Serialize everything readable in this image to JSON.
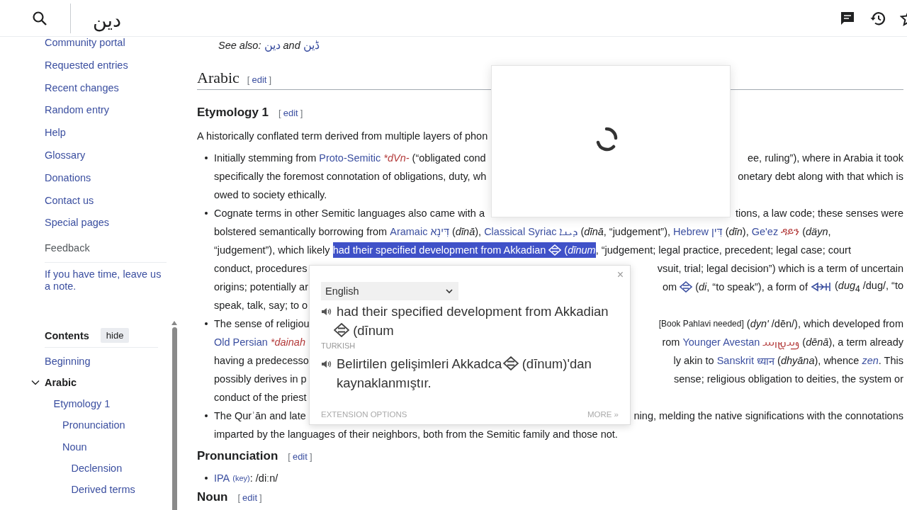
{
  "header": {
    "title": "دين"
  },
  "sidebar": {
    "nav_links": [
      "Community portal",
      "Requested entries",
      "Recent changes",
      "Random entry",
      "Help",
      "Glossary",
      "Donations",
      "Contact us",
      "Special pages"
    ],
    "feedback": {
      "title": "Feedback",
      "note": "If you have time, leave us a note."
    },
    "contents": {
      "title": "Contents",
      "hide_button": "hide",
      "items": [
        {
          "label": "Beginning",
          "selected": false
        },
        {
          "label": "Arabic",
          "selected": true,
          "expanded": true,
          "children": [
            {
              "label": "Etymology 1",
              "selected": false,
              "children": [
                {
                  "label": "Pronunciation",
                  "selected": false
                },
                {
                  "label": "Noun",
                  "selected": false,
                  "children": [
                    {
                      "label": "Declension",
                      "selected": false
                    },
                    {
                      "label": "Derived terms",
                      "selected": false
                    }
                  ]
                }
              ]
            }
          ]
        }
      ]
    }
  },
  "article": [
    {
      "kind": "see_also",
      "segs": [
        {
          "kind": "text",
          "text": "*See also:* "
        },
        {
          "kind": "link",
          "text": "دين"
        },
        {
          "kind": "text",
          "text": " *and* "
        },
        {
          "kind": "link",
          "text": "ڈین"
        }
      ]
    },
    {
      "kind": "h2",
      "text": "Arabic",
      "edit": {
        "open": "[",
        "label": "edit",
        "close": "]"
      }
    },
    {
      "kind": "h3",
      "text": "Etymology 1",
      "edit": {
        "open": "[",
        "label": "edit",
        "close": "]"
      }
    },
    {
      "kind": "para",
      "lines": [
        {
          "left": [
            {
              "kind": "text",
              "text": "A historically conflated term derived from multiple layers of phon"
            }
          ]
        }
      ]
    },
    {
      "kind": "bullet",
      "lines": [
        {
          "left": [
            {
              "kind": "text",
              "text": "Initially stemming from "
            },
            {
              "kind": "link",
              "text": "Proto-Semitic"
            },
            {
              "kind": "red_term",
              "text": "*dVn-"
            },
            {
              "kind": "text",
              "text": " (“obligated cond"
            }
          ],
          "right": [
            {
              "kind": "text",
              "text": "ee, ruling”), where in Arabia it took"
            }
          ]
        },
        {
          "left": [
            {
              "kind": "text",
              "text": "specifically the foremost connotation of obligations, duty, wh"
            }
          ],
          "right": [
            {
              "kind": "text",
              "text": "onetary debt along with that which is"
            }
          ]
        },
        {
          "left": [
            {
              "kind": "text",
              "text": "owed to society ethically."
            }
          ]
        }
      ]
    },
    {
      "kind": "bullet",
      "lines": [
        {
          "left": [
            {
              "kind": "text",
              "text": "Cognate terms in other Semitic languages also came with a"
            }
          ],
          "right": [
            {
              "kind": "text",
              "text": "tions, a law code; these senses were"
            }
          ]
        },
        {
          "left": [
            {
              "kind": "text",
              "text": "bolstered semantically borrowing from "
            },
            {
              "kind": "link",
              "text": "Aramaic"
            },
            {
              "kind": "link",
              "text": "דִּינָא"
            },
            {
              "kind": "text",
              "text": " (*dīnā*), "
            },
            {
              "kind": "link",
              "text": "Classical Syriac"
            },
            {
              "kind": "link",
              "text": "ܕܝܢܐ"
            },
            {
              "kind": "text",
              "text": " (*dīnā*, “judgement”), "
            },
            {
              "kind": "link",
              "text": "Hebrew"
            },
            {
              "kind": "link",
              "text": "דִּין"
            },
            {
              "kind": "text",
              "text": " (*dīn*), "
            },
            {
              "kind": "link",
              "text": "Ge'ez"
            },
            {
              "kind": "red_word",
              "text": "ዳይን"
            },
            {
              "kind": "text",
              "text": " (*däyn*,"
            }
          ]
        },
        {
          "left": [
            {
              "kind": "text",
              "text": "“judgement”), which likely "
            },
            {
              "kind": "text",
              "text": "had their specified development from Akkadian ",
              "highlighted": true
            },
            {
              "kind": "cuneiform",
              "highlighted": true
            },
            {
              "kind": "text",
              "text": " (*dīnum*",
              "highlighted": true
            },
            {
              "kind": "text",
              "text": ", “judgement; legal practice, precedent; legal case; court"
            }
          ]
        },
        {
          "left": [
            {
              "kind": "text",
              "text": "conduct, procedures"
            }
          ],
          "right": [
            {
              "kind": "text",
              "text": "vsuit, trial; legal decision”) which is a term of uncertain"
            }
          ]
        },
        {
          "left": [
            {
              "kind": "text",
              "text": "origins; potentially ar"
            }
          ],
          "right": [
            {
              "kind": "text",
              "text": "om "
            },
            {
              "kind": "cuneiform"
            },
            {
              "kind": "text",
              "text": " (*di*, “to speak”), a form of "
            },
            {
              "kind": "cuneiform_wide"
            },
            {
              "kind": "text",
              "text": " (*dug*$_{4}$ /dug/, “to"
            }
          ]
        },
        {
          "left": [
            {
              "kind": "text",
              "text": "speak, talk, say; to o"
            }
          ]
        }
      ]
    },
    {
      "kind": "bullet",
      "lines": [
        {
          "left": [
            {
              "kind": "text",
              "text": "The sense of religiou"
            }
          ],
          "right": [
            {
              "kind": "note",
              "text": "[Book Pahlavi needed]"
            },
            {
              "kind": "text",
              "text": " (*dyn'* /dēn/), which developed from"
            }
          ]
        },
        {
          "left": [
            {
              "kind": "link",
              "text": "Old Persian"
            },
            {
              "kind": "red_term",
              "text": "*dainah"
            }
          ],
          "right": [
            {
              "kind": "text",
              "text": "rom "
            },
            {
              "kind": "link",
              "text": "Younger Avestan"
            },
            {
              "kind": "red_word",
              "text": "𐬛𐬀𐬉𐬥𐬁"
            },
            {
              "kind": "text",
              "text": " (*dēnā*), a term already"
            }
          ]
        },
        {
          "left": [
            {
              "kind": "text",
              "text": "having a predecesso"
            }
          ],
          "right": [
            {
              "kind": "text",
              "text": "ly akin to "
            },
            {
              "kind": "link",
              "text": "Sanskrit"
            },
            {
              "kind": "link",
              "text": "ध्यान"
            },
            {
              "kind": "text",
              "text": " (*dhyāna*), whence "
            },
            {
              "kind": "link",
              "text": "*zen*"
            },
            {
              "kind": "text",
              "text": ". This"
            }
          ]
        },
        {
          "left": [
            {
              "kind": "text",
              "text": "possibly derives in p"
            }
          ],
          "right": [
            {
              "kind": "text",
              "text": "sense; religious obligation to deities, the system or"
            }
          ]
        },
        {
          "left": [
            {
              "kind": "text",
              "text": "conduct of the priest"
            }
          ]
        }
      ]
    },
    {
      "kind": "bullet",
      "lines": [
        {
          "left": [
            {
              "kind": "text",
              "text": "The Qurʾān and late"
            }
          ],
          "right": [
            {
              "kind": "text",
              "text": "ning, melding the native significations with the connotations"
            }
          ]
        },
        {
          "left": [
            {
              "kind": "text",
              "text": "imparted by the languages of their neighbors, both from the Semitic family and those not."
            }
          ]
        }
      ]
    },
    {
      "kind": "h3",
      "text": "Pronunciation",
      "edit": {
        "open": "[",
        "label": "edit",
        "close": "]"
      }
    },
    {
      "kind": "bullet",
      "lines": [
        {
          "left": [
            {
              "kind": "link",
              "text": "IPA"
            },
            {
              "kind": "sup_link",
              "text": "(key)"
            },
            {
              "kind": "text",
              "text": ": /diːn/"
            }
          ]
        }
      ]
    },
    {
      "kind": "h3",
      "text": "Noun",
      "edit": {
        "open": "[",
        "label": "edit",
        "close": "]"
      }
    }
  ],
  "loading_popup": {
    "loading": true
  },
  "translate_popup": {
    "close": "×",
    "language": "English",
    "source": [
      {
        "kind": "text",
        "text": "had their specified development from Akkadian"
      },
      {
        "kind": "cuneiform"
      },
      {
        "kind": "text",
        "text": "(dīnum"
      }
    ],
    "target_language": "TURKISH",
    "translation": [
      {
        "kind": "text",
        "text": "Belirtilen gelişimleri Akkadca"
      },
      {
        "kind": "cuneiform"
      },
      {
        "kind": "text",
        "text": "(dīnum)'dan kaynaklanmıştır."
      }
    ],
    "options": "EXTENSION OPTIONS",
    "more": "MORE »"
  }
}
